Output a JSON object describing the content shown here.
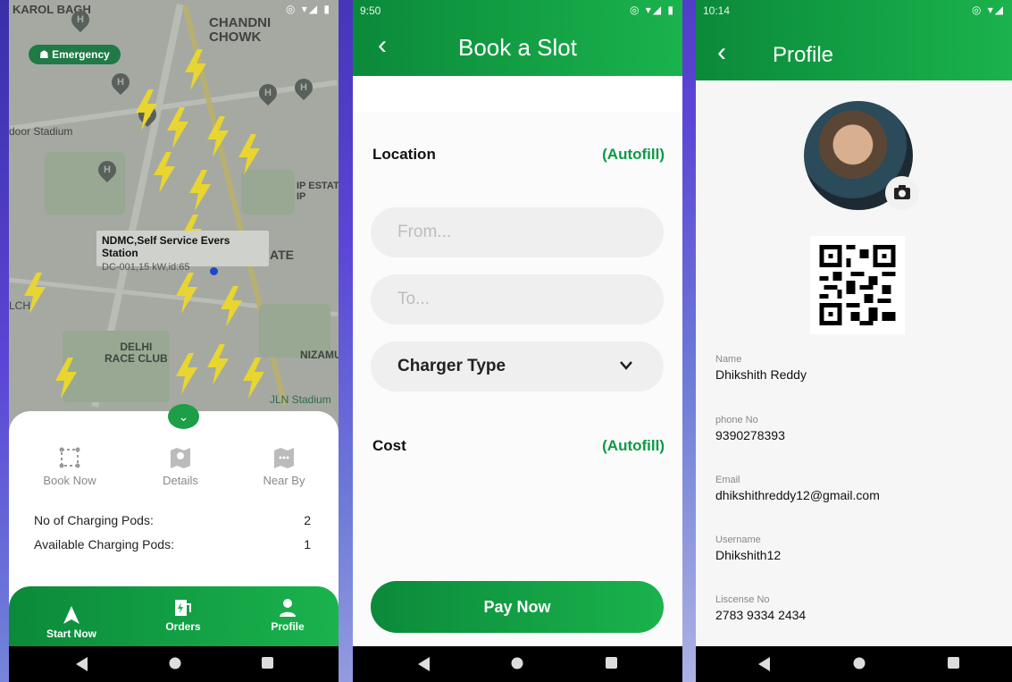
{
  "map_screen": {
    "map_labels": {
      "karol_bagh": "KAROL BAGH",
      "chandni_chowk": "CHANDNI\nCHOWK",
      "stadium": "door Stadium",
      "ip_estate": "IP ESTAT\nIP",
      "gate": "ATE",
      "lch": "LCH",
      "delhi_race_club": "DELHI\nRACE CLUB",
      "nizamu": "NIZAMU",
      "jln": "JLN Stadium"
    },
    "emergency_label": "Emergency",
    "callout": {
      "title": "NDMC,Self Service Evers Station",
      "subtitle": "DC-001,15 kW,id:65"
    },
    "actions": [
      {
        "label": "Book Now",
        "icon": "grid-select-icon"
      },
      {
        "label": "Details",
        "icon": "map-pin-icon"
      },
      {
        "label": "Near By",
        "icon": "map-chat-icon"
      }
    ],
    "info": [
      {
        "label": "No of Charging Pods:",
        "value": "2"
      },
      {
        "label": "Available Charging Pods:",
        "value": "1"
      }
    ],
    "nav": [
      {
        "label": "Start Now",
        "icon": "navigation-arrow-icon"
      },
      {
        "label": "Orders",
        "icon": "ev-charger-icon"
      },
      {
        "label": "Profile",
        "icon": "person-icon"
      }
    ]
  },
  "book_screen": {
    "status_time": "9:50",
    "title": "Book a Slot",
    "location_label": "Location",
    "location_autofill": "(Autofill)",
    "from_placeholder": "From...",
    "to_placeholder": "To...",
    "charger_type_label": "Charger Type",
    "cost_label": "Cost",
    "cost_autofill": "(Autofill)",
    "pay_button": "Pay Now"
  },
  "profile_screen": {
    "status_time": "10:14",
    "title": "Profile",
    "fields": [
      {
        "label": "Name",
        "value": "Dhikshith Reddy"
      },
      {
        "label": "phone No",
        "value": "9390278393"
      },
      {
        "label": "Email",
        "value": "dhikshithreddy12@gmail.com"
      },
      {
        "label": "Username",
        "value": "Dhikshith12"
      },
      {
        "label": "Liscense No",
        "value": "2783 9334 2434"
      }
    ]
  },
  "colors": {
    "brand_green": "#1ab34d",
    "brand_green_dark": "#0b8a3a",
    "autofill_green": "#0b9a45",
    "map_bolt": "#e8d530"
  }
}
